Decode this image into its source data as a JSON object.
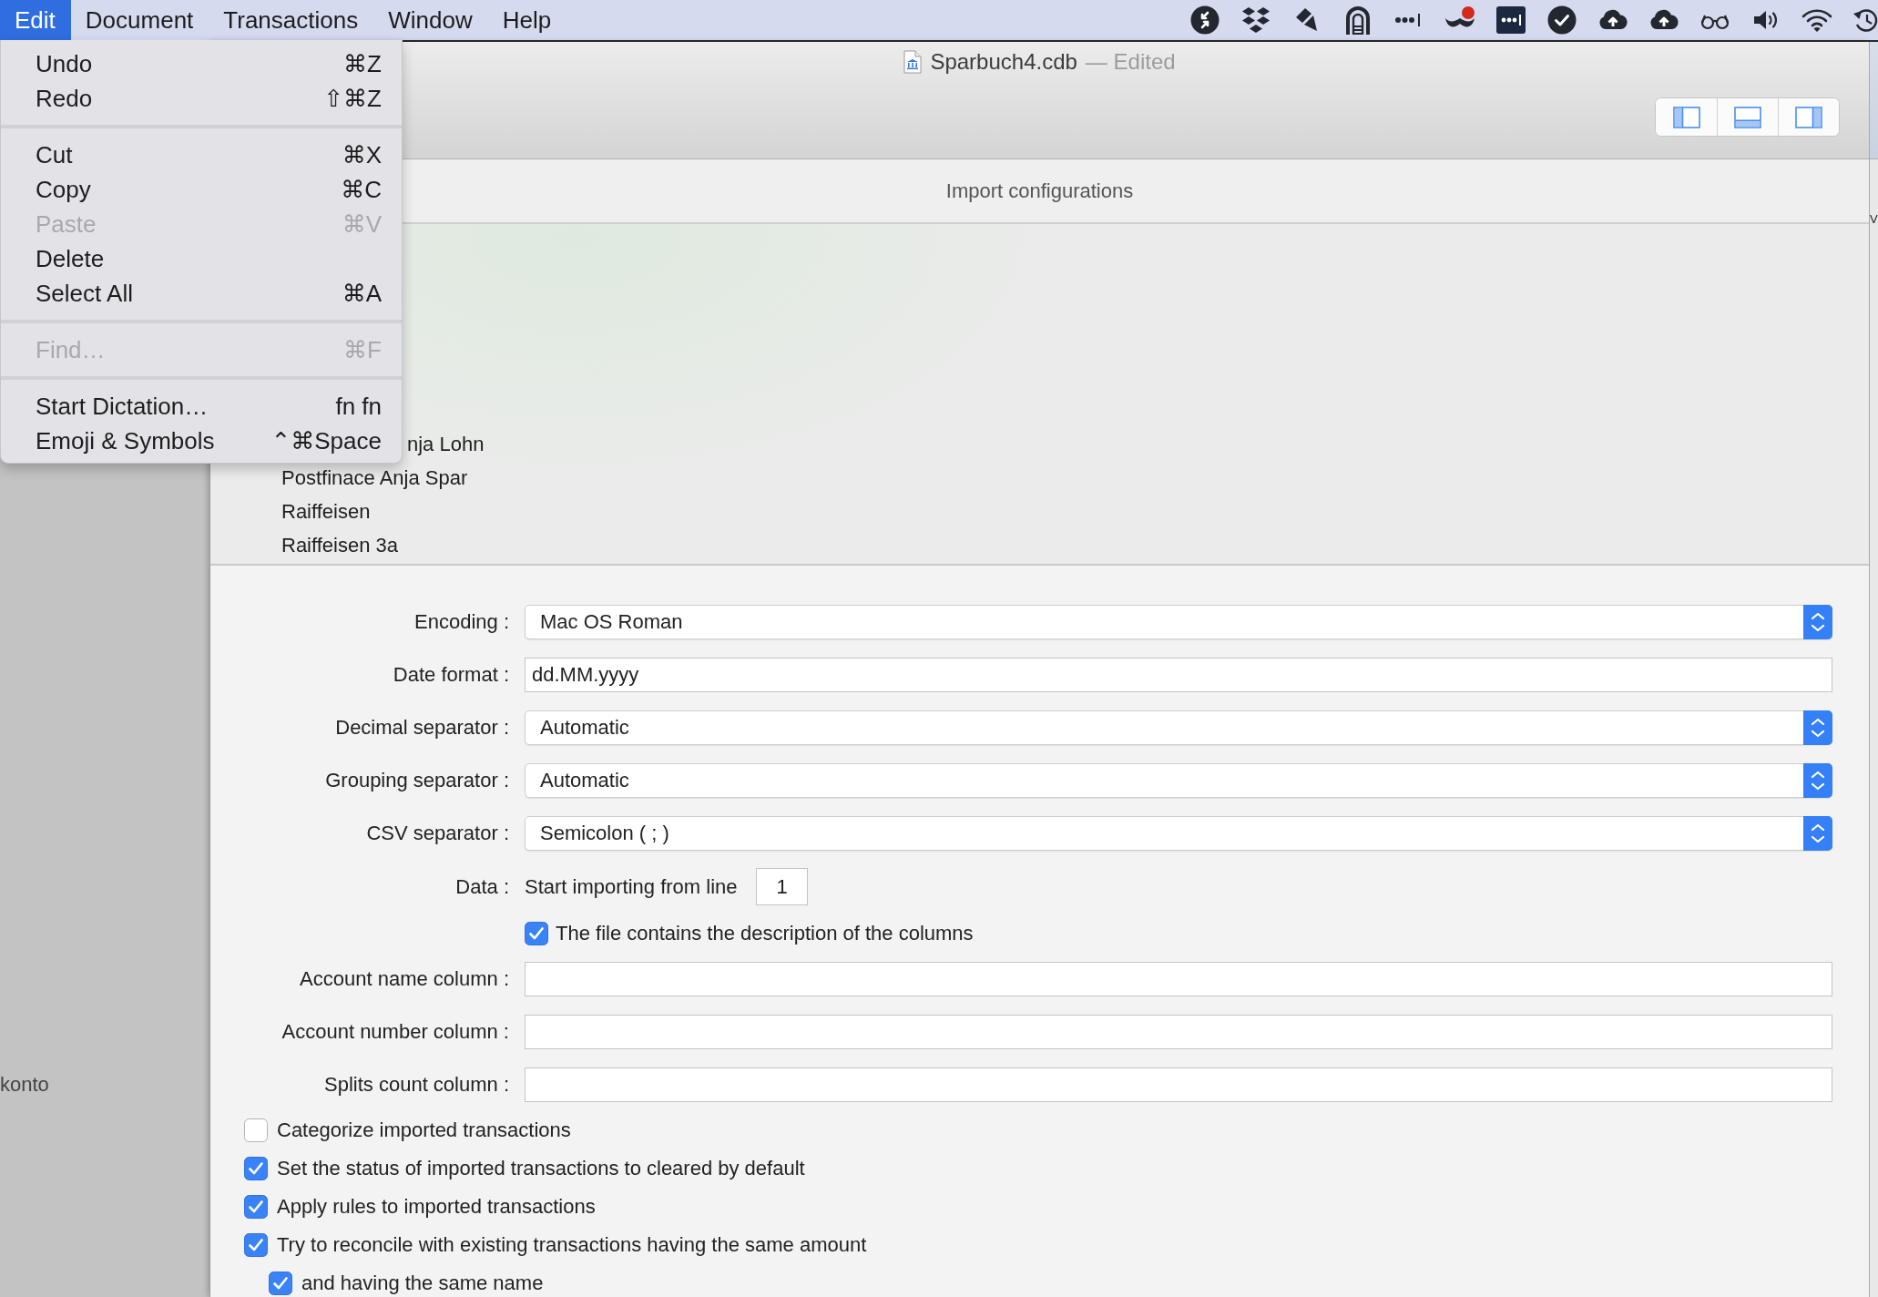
{
  "menu_bar": {
    "items": [
      {
        "label": "Edit",
        "selected": true
      },
      {
        "label": "Document",
        "selected": false
      },
      {
        "label": "Transactions",
        "selected": false
      },
      {
        "label": "Window",
        "selected": false
      },
      {
        "label": "Help",
        "selected": false
      }
    ]
  },
  "edit_menu": {
    "items": [
      {
        "kind": "item",
        "label": "Undo",
        "shortcut": "⌘Z",
        "disabled": false
      },
      {
        "kind": "item",
        "label": "Redo",
        "shortcut": "⇧⌘Z",
        "disabled": false
      },
      {
        "kind": "separator"
      },
      {
        "kind": "item",
        "label": "Cut",
        "shortcut": "⌘X",
        "disabled": false
      },
      {
        "kind": "item",
        "label": "Copy",
        "shortcut": "⌘C",
        "disabled": false
      },
      {
        "kind": "item",
        "label": "Paste",
        "shortcut": "⌘V",
        "disabled": true
      },
      {
        "kind": "item",
        "label": "Delete",
        "disabled": false
      },
      {
        "kind": "item",
        "label": "Select All",
        "shortcut": "⌘A",
        "disabled": false
      },
      {
        "kind": "separator"
      },
      {
        "kind": "item",
        "label": "Find…",
        "shortcut": "⌘F",
        "disabled": true
      },
      {
        "kind": "separator"
      },
      {
        "kind": "item",
        "label": "Start Dictation…",
        "shortcut": "fn fn",
        "disabled": false
      },
      {
        "kind": "item",
        "label": "Emoji & Symbols",
        "shortcut": "⌃⌘Space",
        "disabled": false
      }
    ]
  },
  "background_window": {
    "sidebar_item": "konto"
  },
  "window": {
    "title": "Sparbuch4.cdb",
    "status": "— Edited"
  },
  "import_panel": {
    "title": "Import configurations",
    "configurations": [
      {
        "label": "nja Lohn",
        "selected": false
      },
      {
        "label": "Postfinace Anja Spar",
        "selected": false
      },
      {
        "label": "Raiffeisen",
        "selected": false
      },
      {
        "label": "Raiffeisen 3a",
        "selected": false
      }
    ],
    "form": [
      {
        "kind": "popup",
        "label": "Encoding :",
        "value": "Mac OS Roman"
      },
      {
        "kind": "text",
        "label": "Date format :",
        "value": "dd.MM.yyyy"
      },
      {
        "kind": "popup",
        "label": "Decimal separator :",
        "value": "Automatic"
      },
      {
        "kind": "popup",
        "label": "Grouping separator :",
        "value": "Automatic"
      },
      {
        "kind": "popup",
        "label": "CSV separator :",
        "value": "Semicolon ( ; )"
      },
      {
        "kind": "line",
        "label": "Data :",
        "text": "Start importing from line",
        "value": "1"
      },
      {
        "kind": "checkbox",
        "label": "The file contains the description of the columns",
        "checked": true
      },
      {
        "kind": "text",
        "label": "Account name column :"
      },
      {
        "kind": "text",
        "label": "Account number column :"
      },
      {
        "kind": "text",
        "label": "Splits count column :"
      }
    ],
    "options": [
      {
        "label": "Categorize imported transactions",
        "checked": false
      },
      {
        "label": "Set the status of imported transactions to cleared by default",
        "checked": true
      },
      {
        "label": "Apply rules to imported transactions",
        "checked": true
      },
      {
        "label": "Try to reconcile with existing transactions having the same amount",
        "checked": true,
        "children": [
          {
            "label": "and having the same name",
            "checked": true
          }
        ]
      }
    ]
  },
  "side_window": {
    "text": "V"
  }
}
